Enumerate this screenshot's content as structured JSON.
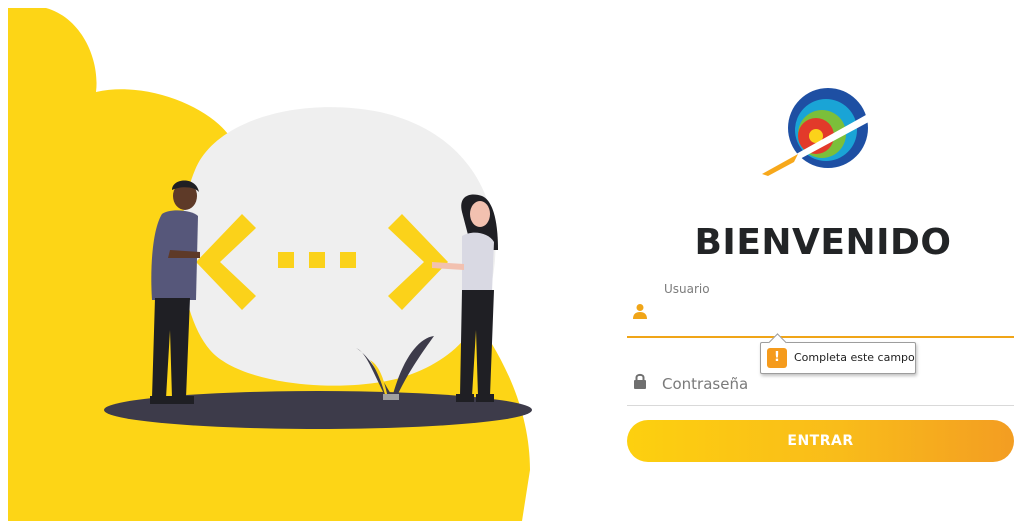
{
  "welcome": {
    "title": "BIENVENIDO"
  },
  "form": {
    "username_label": "Usuario",
    "username_value": "",
    "password_placeholder": "Contraseña",
    "submit_label": "ENTRAR"
  },
  "validation": {
    "message": "Completa este campo",
    "icon": "!"
  },
  "colors": {
    "accent": "#f9bc1a",
    "accent_dark": "#f39d22",
    "illustration_yellow": "#fdd516",
    "title": "#222426"
  },
  "icons": {
    "username": "user-icon",
    "password": "lock-icon",
    "warning": "warning-icon"
  }
}
